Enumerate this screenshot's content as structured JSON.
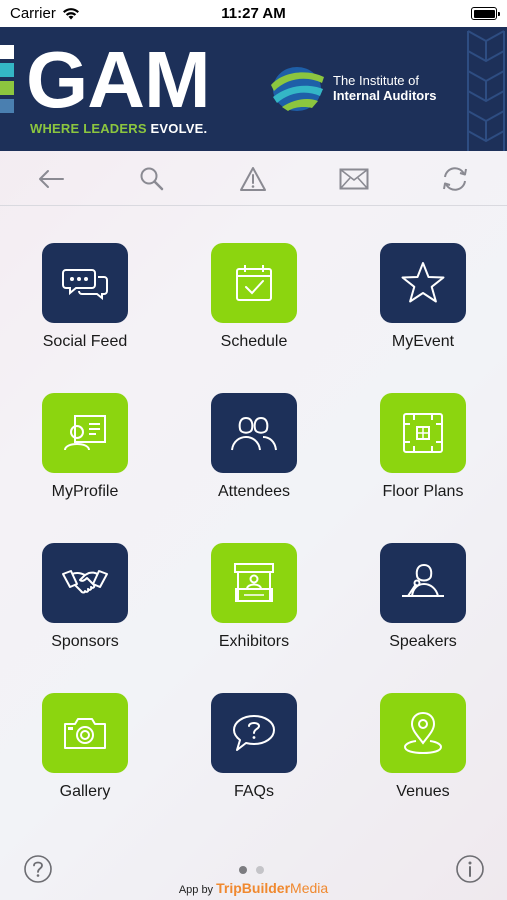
{
  "status_bar": {
    "carrier": "Carrier",
    "time": "11:27 AM"
  },
  "banner": {
    "title": "GAM",
    "tagline_green": "WHERE LEADERS ",
    "tagline_white": "EVOLVE.",
    "iia_line1": "The Institute of",
    "iia_line2": "Internal Auditors",
    "colors": {
      "navy": "#1d3059",
      "lime": "#8cc63f"
    }
  },
  "toolbar": {
    "items": [
      {
        "icon": "back-arrow-icon"
      },
      {
        "icon": "search-icon"
      },
      {
        "icon": "alert-icon"
      },
      {
        "icon": "mail-icon"
      },
      {
        "icon": "refresh-icon"
      }
    ]
  },
  "grid": {
    "items": [
      {
        "label": "Social Feed",
        "icon": "chat-bubbles-icon",
        "color": "navy"
      },
      {
        "label": "Schedule",
        "icon": "calendar-check-icon",
        "color": "lime"
      },
      {
        "label": "MyEvent",
        "icon": "star-icon",
        "color": "navy"
      },
      {
        "label": "MyProfile",
        "icon": "profile-card-icon",
        "color": "lime"
      },
      {
        "label": "Attendees",
        "icon": "people-icon",
        "color": "navy"
      },
      {
        "label": "Floor Plans",
        "icon": "floor-plan-icon",
        "color": "lime"
      },
      {
        "label": "Sponsors",
        "icon": "handshake-icon",
        "color": "navy"
      },
      {
        "label": "Exhibitors",
        "icon": "booth-icon",
        "color": "lime"
      },
      {
        "label": "Speakers",
        "icon": "speaker-icon",
        "color": "navy"
      },
      {
        "label": "Gallery",
        "icon": "camera-icon",
        "color": "lime"
      },
      {
        "label": "FAQs",
        "icon": "question-bubble-icon",
        "color": "navy"
      },
      {
        "label": "Venues",
        "icon": "map-pin-icon",
        "color": "lime"
      }
    ]
  },
  "footer": {
    "help_icon": "help-icon",
    "info_icon": "info-icon",
    "page_count": 2,
    "current_page": 1,
    "credit_prefix": "App by ",
    "credit_brand": "TripBuilder",
    "credit_brand2": "Media"
  }
}
